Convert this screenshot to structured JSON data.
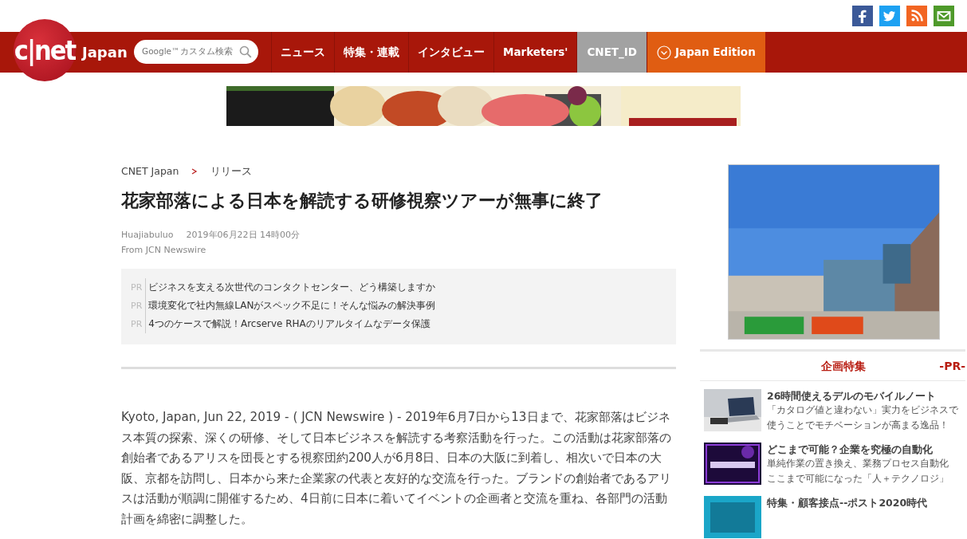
{
  "social": [
    {
      "kind": "facebook"
    },
    {
      "kind": "twitter"
    },
    {
      "kind": "rss"
    },
    {
      "kind": "mail"
    }
  ],
  "header": {
    "logo": "c|net",
    "edition": "Japan",
    "search": {
      "placeholder": "Google™カスタム検索"
    },
    "nav": [
      {
        "label": "ニュース",
        "kind": "link"
      },
      {
        "label": "特集・連載",
        "kind": "link"
      },
      {
        "label": "インタビュー",
        "kind": "link"
      },
      {
        "label": "Marketers'",
        "kind": "link"
      },
      {
        "label": "CNET_ID",
        "kind": "account"
      },
      {
        "label": "Japan Edition",
        "kind": "edition"
      }
    ]
  },
  "breadcrumb": [
    "CNET Japan",
    "リリース"
  ],
  "article": {
    "title": "花家部落による日本を解読する研修視察ツアーが無事に終了",
    "author": "Huajiabuluo",
    "date": "2019年06月22日 14時00分",
    "source": "From JCN Newswire",
    "pr_links": [
      {
        "tag": "PR",
        "text": "ビジネスを支える次世代のコンタクトセンター、どう構築しますか"
      },
      {
        "tag": "PR",
        "text": "環境変化で社内無線LANがスペック不足に！そんな悩みの解決事例"
      },
      {
        "tag": "PR",
        "text": "4つのケースで解説！Arcserve RHAのリアルタイムなデータ保護"
      }
    ],
    "body": "Kyoto, Japan, Jun 22, 2019 - ( JCN Newswire ) - 2019年6月7日から13日まで、花家部落はビジネス本質の探索、深くの研修、そして日本ビジネスを解読する考察活動を行った。この活動は花家部落の創始者であるアリスを団長とする視察団約200人が6月8日、日本の大阪に到着し、相次いで日本の大阪、京都を訪問し、日本から来た企業家の代表と友好的な交流を行った。ブランドの創始者であるアリスは活動が順調に開催するため、4日前に日本に着いてイベントの企画者と交流を重ね、各部門の活動計画を綿密に調整した。"
  },
  "sidebar": {
    "heading": "企画特集",
    "pr_label": "-PR-",
    "items": [
      {
        "title": "26時間使えるデルのモバイルノート",
        "desc": [
          "「カタログ値と違わない」実力をビジネスで",
          "使うことでモチベーションが高まる逸品！"
        ]
      },
      {
        "title": "どこまで可能？企業を究極の自動化",
        "desc": [
          "単純作業の置き換え、業務プロセス自動化",
          "ここまで可能になった「人＋テクノロジ」"
        ]
      },
      {
        "title": "特集・顧客接点--ポスト2020時代"
      }
    ]
  }
}
